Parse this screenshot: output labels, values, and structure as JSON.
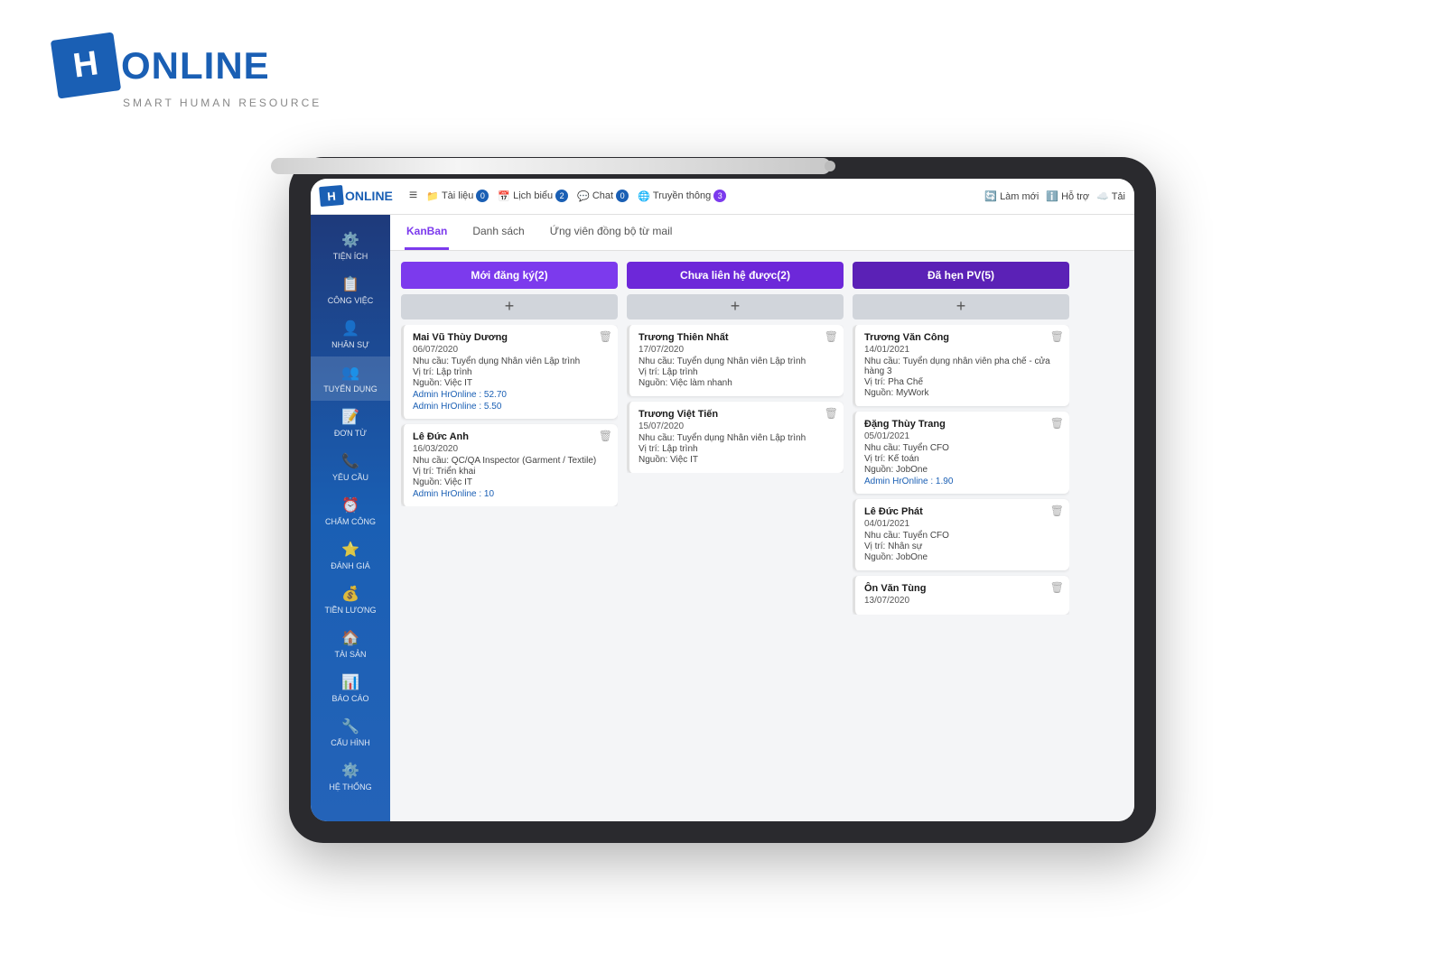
{
  "logo": {
    "h_letter": "H",
    "brand_name": "ONLINE",
    "subtitle": "SMART HUMAN RESOURCE"
  },
  "topbar": {
    "hamburger": "≡",
    "nav_items": [
      {
        "icon": "📁",
        "label": "Tài liệu",
        "badge": "0",
        "badge_color": "blue"
      },
      {
        "icon": "📅",
        "label": "Lịch biểu",
        "badge": "2",
        "badge_color": "blue"
      },
      {
        "icon": "💬",
        "label": "Chat",
        "badge": "0",
        "badge_color": "blue"
      },
      {
        "icon": "🌐",
        "label": "Truyền thông",
        "badge": "3",
        "badge_color": "purple"
      }
    ],
    "right_actions": [
      {
        "icon": "🔄",
        "label": "Làm mới"
      },
      {
        "icon": "ℹ️",
        "label": "Hỗ trợ"
      },
      {
        "icon": "☁️",
        "label": "Tải"
      }
    ]
  },
  "sidebar": {
    "items": [
      {
        "icon": "⚙️",
        "label": "TIỆN ÍCH"
      },
      {
        "icon": "📋",
        "label": "CÔNG VIỆC"
      },
      {
        "icon": "👤",
        "label": "NHÂN SỰ"
      },
      {
        "icon": "👥",
        "label": "TUYỂN DỤNG",
        "active": true
      },
      {
        "icon": "📝",
        "label": "ĐƠN TỪ"
      },
      {
        "icon": "📞",
        "label": "YÊU CẦU"
      },
      {
        "icon": "⏰",
        "label": "CHẤM CÔNG"
      },
      {
        "icon": "⭐",
        "label": "ĐÁNH GIÁ"
      },
      {
        "icon": "💰",
        "label": "TIỀN LƯƠNG"
      },
      {
        "icon": "🏠",
        "label": "TÀI SẢN"
      },
      {
        "icon": "📊",
        "label": "BÁO CÁO"
      },
      {
        "icon": "🔧",
        "label": "CẤU HÌNH"
      },
      {
        "icon": "⚙️",
        "label": "HỆ THỐNG"
      }
    ]
  },
  "tabs": [
    {
      "label": "KanBan",
      "active": true
    },
    {
      "label": "Danh sách",
      "active": false
    },
    {
      "label": "Ứng viên đồng bộ từ mail",
      "active": false
    }
  ],
  "kanban": {
    "columns": [
      {
        "title": "Mới đăng ký(2)",
        "color": "purple",
        "cards": [
          {
            "name": "Mai Vũ Thùy Dương",
            "date": "06/07/2020",
            "nhu_cau": "Tuyển dụng Nhân viên Lập trình",
            "vi_tri": "Lập trình",
            "nguon": "Việc IT",
            "admin_lines": [
              "Admin HrOnline : 52.70",
              "Admin HrOnline : 5.50"
            ]
          },
          {
            "name": "Lê Đức Anh",
            "date": "16/03/2020",
            "nhu_cau": "QC/QA Inspector (Garment / Textile)",
            "vi_tri": "Triển khai",
            "nguon": "Việc IT",
            "admin_lines": [
              "Admin HrOnline : 10"
            ]
          }
        ]
      },
      {
        "title": "Chưa liên hệ được(2)",
        "color": "violet",
        "cards": [
          {
            "name": "Trương Thiên Nhất",
            "date": "17/07/2020",
            "nhu_cau": "Tuyển dụng Nhân viên Lập trình",
            "vi_tri": "Lập trình",
            "nguon": "Việc làm nhanh",
            "admin_lines": []
          },
          {
            "name": "Trương Việt Tiến",
            "date": "15/07/2020",
            "nhu_cau": "Tuyển dụng Nhân viên Lập trình",
            "vi_tri": "Lập trình",
            "nguon": "Việc IT",
            "admin_lines": []
          }
        ]
      },
      {
        "title": "Đã hẹn PV(5)",
        "color": "dark-purple",
        "cards": [
          {
            "name": "Trương Văn Công",
            "date": "14/01/2021",
            "nhu_cau": "Tuyển dụng nhân viên pha chế - cửa hàng 3",
            "vi_tri": "Pha Chế",
            "nguon": "MyWork",
            "admin_lines": []
          },
          {
            "name": "Đặng Thùy Trang",
            "date": "05/01/2021",
            "nhu_cau": "Tuyển CFO",
            "vi_tri": "Kế toán",
            "nguon": "JobOne",
            "admin_lines": [
              "Admin HrOnline : 1.90"
            ]
          },
          {
            "name": "Lê Đức Phát",
            "date": "04/01/2021",
            "nhu_cau": "Tuyển CFO",
            "vi_tri": "Nhân sự",
            "nguon": "JobOne",
            "admin_lines": []
          },
          {
            "name": "Ôn Văn Tùng",
            "date": "13/07/2020",
            "nhu_cau": "",
            "vi_tri": "",
            "nguon": "",
            "admin_lines": []
          }
        ]
      }
    ]
  }
}
